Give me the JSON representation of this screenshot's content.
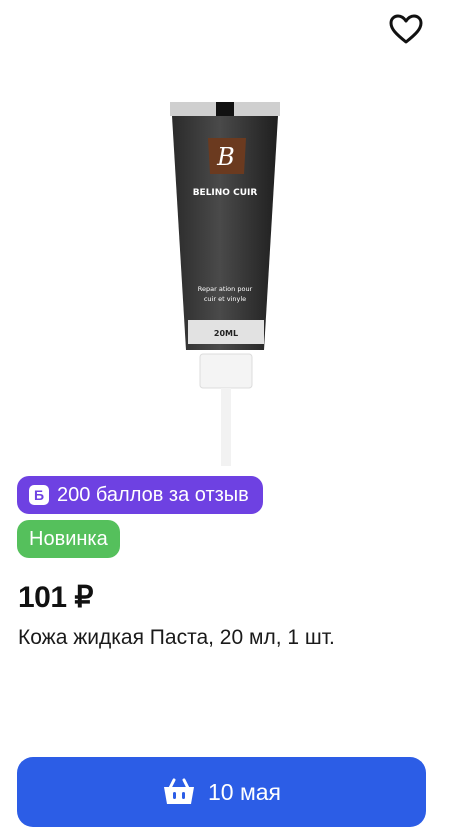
{
  "product": {
    "points_badge": "200 баллов за отзыв",
    "points_icon": "Б",
    "new_badge": "Новинка",
    "price": "101 ₽",
    "title": "Кожа жидкая Паста, 20 мл, 1 шт.",
    "image_text": {
      "brand": "BELINO CUIR",
      "line1": "Repar ation pour",
      "line2": "cuir et vinyle",
      "volume": "20ML",
      "logo_letter": "B"
    }
  },
  "cart_button": {
    "label": "10 мая",
    "icon": "basket-icon",
    "color": "#2c5de6"
  },
  "favorite": {
    "icon": "heart-icon"
  },
  "colors": {
    "points_badge": "#6e41e2",
    "new_badge": "#55c05c"
  }
}
